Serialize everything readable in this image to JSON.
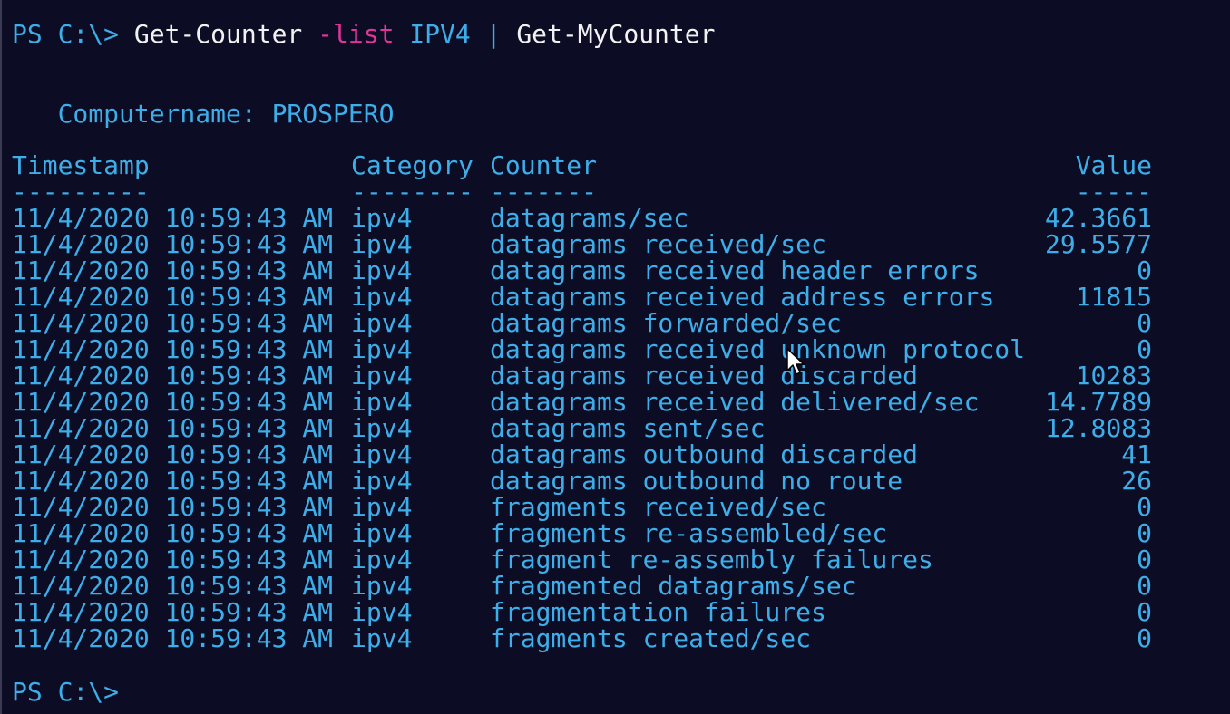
{
  "command": {
    "prompt": "PS C:\\> ",
    "cmdlet": "Get-Counter",
    "param": "-list",
    "arg": "IPV4",
    "pipe": "|",
    "cmdlet2": "Get-MyCounter"
  },
  "computer": "   Computername: PROSPERO",
  "headers": {
    "timestamp": "Timestamp",
    "category": "Category",
    "counter": "Counter",
    "value": "Value",
    "timestamp_ul": "---------",
    "category_ul": "--------",
    "counter_ul": "-------",
    "value_ul": "-----"
  },
  "rows": [
    {
      "timestamp": "11/4/2020 10:59:43 AM",
      "category": "ipv4",
      "counter": "datagrams/sec",
      "value": "42.3661"
    },
    {
      "timestamp": "11/4/2020 10:59:43 AM",
      "category": "ipv4",
      "counter": "datagrams received/sec",
      "value": "29.5577"
    },
    {
      "timestamp": "11/4/2020 10:59:43 AM",
      "category": "ipv4",
      "counter": "datagrams received header errors",
      "value": "0"
    },
    {
      "timestamp": "11/4/2020 10:59:43 AM",
      "category": "ipv4",
      "counter": "datagrams received address errors",
      "value": "11815"
    },
    {
      "timestamp": "11/4/2020 10:59:43 AM",
      "category": "ipv4",
      "counter": "datagrams forwarded/sec",
      "value": "0"
    },
    {
      "timestamp": "11/4/2020 10:59:43 AM",
      "category": "ipv4",
      "counter": "datagrams received unknown protocol",
      "value": "0"
    },
    {
      "timestamp": "11/4/2020 10:59:43 AM",
      "category": "ipv4",
      "counter": "datagrams received discarded",
      "value": "10283"
    },
    {
      "timestamp": "11/4/2020 10:59:43 AM",
      "category": "ipv4",
      "counter": "datagrams received delivered/sec",
      "value": "14.7789"
    },
    {
      "timestamp": "11/4/2020 10:59:43 AM",
      "category": "ipv4",
      "counter": "datagrams sent/sec",
      "value": "12.8083"
    },
    {
      "timestamp": "11/4/2020 10:59:43 AM",
      "category": "ipv4",
      "counter": "datagrams outbound discarded",
      "value": "41"
    },
    {
      "timestamp": "11/4/2020 10:59:43 AM",
      "category": "ipv4",
      "counter": "datagrams outbound no route",
      "value": "26"
    },
    {
      "timestamp": "11/4/2020 10:59:43 AM",
      "category": "ipv4",
      "counter": "fragments received/sec",
      "value": "0"
    },
    {
      "timestamp": "11/4/2020 10:59:43 AM",
      "category": "ipv4",
      "counter": "fragments re-assembled/sec",
      "value": "0"
    },
    {
      "timestamp": "11/4/2020 10:59:43 AM",
      "category": "ipv4",
      "counter": "fragment re-assembly failures",
      "value": "0"
    },
    {
      "timestamp": "11/4/2020 10:59:43 AM",
      "category": "ipv4",
      "counter": "fragmented datagrams/sec",
      "value": "0"
    },
    {
      "timestamp": "11/4/2020 10:59:43 AM",
      "category": "ipv4",
      "counter": "fragmentation failures",
      "value": "0"
    },
    {
      "timestamp": "11/4/2020 10:59:43 AM",
      "category": "ipv4",
      "counter": "fragments created/sec",
      "value": "0"
    }
  ],
  "final_prompt": "PS C:\\>",
  "colors": {
    "background": "#0c0c24",
    "text": "#3daee9",
    "command": "#f2f2f2",
    "parameter": "#e0349a"
  },
  "icons": {
    "cursor": "mouse-pointer-icon"
  }
}
